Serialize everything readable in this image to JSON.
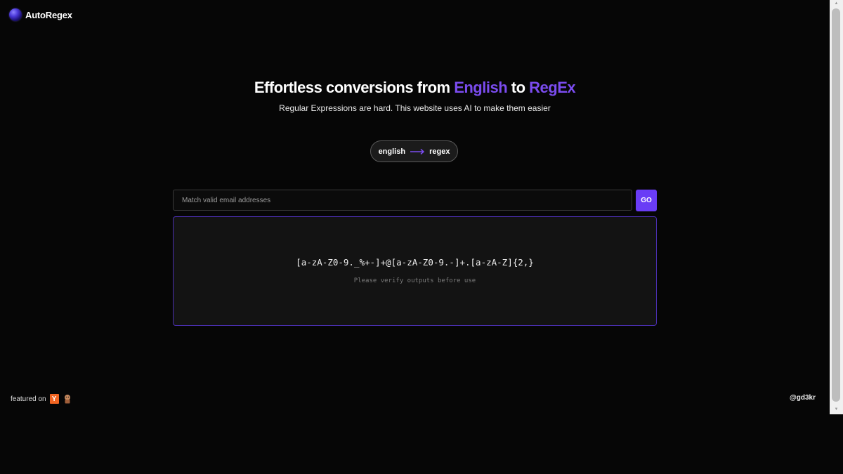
{
  "brand": {
    "name": "AutoRegex",
    "logo_icon": "purple-orb-icon"
  },
  "hero": {
    "title_prefix": "Effortless conversions from ",
    "title_accent1": "English",
    "title_mid": " to ",
    "title_accent2": "RegEx",
    "subtitle": "Regular Expressions are hard. This website uses AI to make them easier"
  },
  "mode_toggle": {
    "from": "english",
    "to": "regex",
    "arrow_icon": "long-arrow-right-icon"
  },
  "prompt": {
    "placeholder": "Match valid email addresses",
    "value": ""
  },
  "go_button": {
    "label": "GO"
  },
  "output": {
    "regex": "[a-zA-Z0-9._%+-]+@[a-zA-Z0-9.-]+.[a-zA-Z]{2,}",
    "note": "Please verify outputs before use"
  },
  "footer": {
    "featured_label": "featured on",
    "yc_icon": "Y",
    "producthunt_icon": "product-hunt-icon",
    "handle": "@gd3kr"
  },
  "colors": {
    "accent": "#7b4cf0",
    "button": "#6a3cf6",
    "background": "#060606"
  }
}
